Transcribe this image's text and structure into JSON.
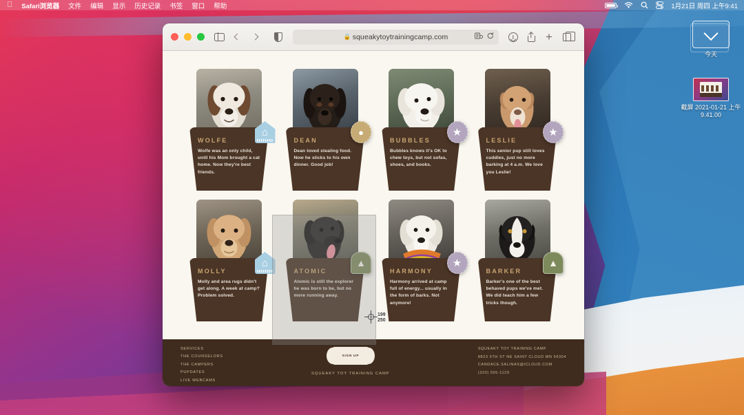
{
  "menubar": {
    "apple_icon": "apple-icon",
    "items": [
      "Safari浏览器",
      "文件",
      "编辑",
      "显示",
      "历史记录",
      "书签",
      "窗口",
      "帮助"
    ],
    "status_icons": [
      "battery-icon",
      "wifi-icon",
      "search-icon",
      "control-center-icon"
    ],
    "clock": "1月21日 周四 上午9:41"
  },
  "desktop": {
    "stack": {
      "label": "今天",
      "icon": "chevron-down-icon"
    },
    "screenshot_file": {
      "label": "截屏 2021-01-21 上午 9.41.00",
      "icon": "image-thumbnail"
    }
  },
  "browser": {
    "window_controls": [
      "close",
      "minimize",
      "zoom"
    ],
    "sidebar_icon": "sidebar-icon",
    "back_icon": "chevron-left-icon",
    "forward_icon": "chevron-right-icon",
    "privacy_icon": "shield-icon",
    "url": "squeakytoytrainingcamp.com",
    "lock_icon": "lock-icon",
    "reader_icon": "reader-icon",
    "reload_icon": "reload-icon",
    "downloads_icon": "download-icon",
    "share_icon": "share-icon",
    "new_tab_icon": "plus-icon",
    "tab_overview_icon": "tabs-icon"
  },
  "page": {
    "campers": [
      {
        "name": "WOLFE",
        "desc": "Wolfe was an only child, until his Mom brought a cat home. Now they're best friends.",
        "badge": "house",
        "badge_glyph": "⌂"
      },
      {
        "name": "DEAN",
        "desc": "Dean loved stealing food. Now he sticks to his own dinner. Good job!",
        "badge": "bone",
        "badge_glyph": "✹"
      },
      {
        "name": "BUBBLES",
        "desc": "Bubbles knows it's OK to chew toys, but not sofas, shoes, and books.",
        "badge": "star",
        "badge_glyph": "★"
      },
      {
        "name": "LESLIE",
        "desc": "This senior pup still loves cuddles, just no more barking at 4 a.m. We love you Leslie!",
        "badge": "star",
        "badge_glyph": "★"
      },
      {
        "name": "MOLLY",
        "desc": "Molly and area rugs didn't get along. A week at camp? Problem solved.",
        "badge": "house",
        "badge_glyph": "⌂"
      },
      {
        "name": "ATOMIC",
        "desc": "Atomic is still the explorer he was born to be, but no more running away.",
        "badge": "tree",
        "badge_glyph": "🌲"
      },
      {
        "name": "HARMONY",
        "desc": "Harmony arrived at camp full of energy... usually in the form of barks. Not anymore!",
        "badge": "star",
        "badge_glyph": "★"
      },
      {
        "name": "BARKER",
        "desc": "Barker's one of the best behaved pups we've met. We did teach him a few tricks though.",
        "badge": "tree",
        "badge_glyph": "🌲"
      }
    ],
    "footer": {
      "nav": [
        "SERVICES",
        "THE COUNSELORS",
        "THE CAMPERS",
        "PUPDATES",
        "LIVE WEBCAMS"
      ],
      "signup_label": "SIGN UP",
      "site_title": "SQUEAKY TOY TRAINING CAMP",
      "contact": [
        "SQUEAKY TOY TRAINING CAMP",
        "8823 5TH ST NE SAINT CLOUD MN 56304",
        "CANDACE.SALINAS@ICLOUD.COM",
        "(320) 555-1129"
      ]
    }
  },
  "capture": {
    "width": "199",
    "height": "250"
  },
  "colors": {
    "card_brown": "#4b3526",
    "card_name": "#c8a571",
    "page_bg": "#faf7f0",
    "footer_bg": "#3f2c1f",
    "badge_house": "#a9cfe3",
    "badge_star": "#b2a5bd",
    "badge_tree": "#7d8a5c"
  }
}
